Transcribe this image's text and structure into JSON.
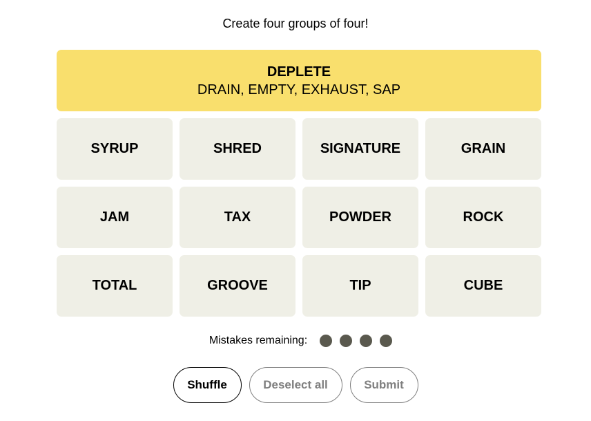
{
  "header": {
    "subtitle": "Create four groups of four!"
  },
  "solved_groups": [
    {
      "category": "DEPLETE",
      "members": "DRAIN, EMPTY, EXHAUST, SAP",
      "color": "#f9df6d"
    }
  ],
  "tiles": [
    "SYRUP",
    "SHRED",
    "SIGNATURE",
    "GRAIN",
    "JAM",
    "TAX",
    "POWDER",
    "ROCK",
    "TOTAL",
    "GROOVE",
    "TIP",
    "CUBE"
  ],
  "mistakes": {
    "label": "Mistakes remaining:",
    "remaining": 4
  },
  "buttons": {
    "shuffle": "Shuffle",
    "deselect_all": "Deselect all",
    "submit": "Submit"
  }
}
